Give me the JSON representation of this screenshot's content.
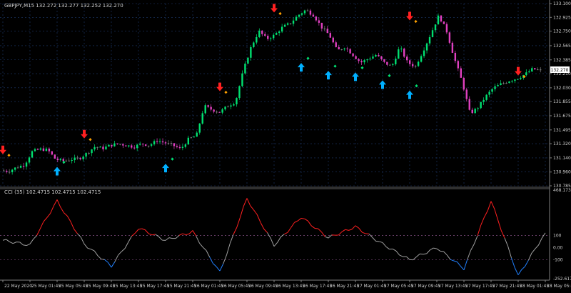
{
  "main": {
    "header": "GBPJPY,M15  132.272 132.277 132.252 132.270",
    "price_labels": [
      "133.100",
      "132.925",
      "132.750",
      "132.565",
      "132.385",
      "132.210",
      "132.030",
      "131.855",
      "131.675",
      "131.495",
      "131.320",
      "131.140",
      "130.960",
      "130.785"
    ],
    "current_price": "132.270"
  },
  "indicator": {
    "header": "CCI (35) 102.4715 102.4715 102.4715",
    "scale_labels": [
      "468.1737",
      "100",
      "0.00",
      "-100",
      "-252.6179"
    ]
  },
  "time_axis": [
    "22 May 2020",
    "25 May 01:45",
    "25 May 05:45",
    "25 May 09:45",
    "25 May 13:45",
    "25 May 17:45",
    "25 May 21:45",
    "26 May 01:45",
    "26 May 05:45",
    "26 May 09:45",
    "26 May 13:45",
    "26 May 17:45",
    "26 May 21:45",
    "27 May 01:45",
    "27 May 05:45",
    "27 May 09:45",
    "27 May 13:45",
    "27 May 17:45",
    "27 May 21:45",
    "28 May 01:45",
    "28 May 05:45"
  ],
  "colors": {
    "bull": "#00e070",
    "bear": "#e040c0",
    "neutral": "#808080",
    "cci_above": "#ff2020",
    "cci_mid": "#a0a0a0",
    "cci_below": "#2080ff",
    "buy_arrow": "#00b0ff",
    "sell_arrow": "#ff2020",
    "grid": "#1e3a6e",
    "text": "#d0d0d0"
  },
  "chart_data": [
    {
      "type": "candlestick",
      "title": "GBPJPY,M15",
      "ylim": [
        130.785,
        133.1
      ],
      "x_ticks": [
        "22 May 2020",
        "25 May 01:45",
        "25 May 05:45",
        "25 May 09:45",
        "25 May 13:45",
        "25 May 17:45",
        "25 May 21:45",
        "26 May 01:45",
        "26 May 05:45",
        "26 May 09:45",
        "26 May 13:45",
        "26 May 17:45",
        "26 May 21:45",
        "27 May 01:45",
        "27 May 05:45",
        "27 May 09:45",
        "27 May 13:45",
        "27 May 17:45",
        "27 May 21:45",
        "28 May 01:45",
        "28 May 05:45"
      ],
      "close_path": [
        130.98,
        130.97,
        131.02,
        131.05,
        131.22,
        131.25,
        131.24,
        131.12,
        131.1,
        131.12,
        131.13,
        131.2,
        131.28,
        131.26,
        131.3,
        131.32,
        131.3,
        131.28,
        131.32,
        131.3,
        131.36,
        131.33,
        131.3,
        131.25,
        131.38,
        131.42,
        131.8,
        131.75,
        131.72,
        131.8,
        131.85,
        132.25,
        132.55,
        132.75,
        132.65,
        132.7,
        132.8,
        132.85,
        132.95,
        133.02,
        132.95,
        132.8,
        132.7,
        132.5,
        132.55,
        132.45,
        132.35,
        132.4,
        132.45,
        132.35,
        132.3,
        132.55,
        132.35,
        132.3,
        132.5,
        132.72,
        132.95,
        132.75,
        132.4,
        132.1,
        131.7,
        131.78,
        131.92,
        132.03,
        132.08,
        132.12,
        132.15,
        132.2,
        132.27,
        132.25
      ],
      "buy_signals": [
        {
          "x": "25 May 05:45",
          "y": 131.08
        },
        {
          "x": "25 May 21:45",
          "y": 131.12
        },
        {
          "x": "26 May 17:45",
          "y": 132.4
        },
        {
          "x": "26 May 21:45",
          "y": 132.3
        },
        {
          "x": "27 May 01:45",
          "y": 132.28
        },
        {
          "x": "27 May 05:45",
          "y": 132.18
        },
        {
          "x": "27 May 09:45",
          "y": 132.05
        }
      ],
      "sell_signals": [
        {
          "x": "22 May 2020",
          "y": 131.15
        },
        {
          "x": "25 May 09:45",
          "y": 131.35
        },
        {
          "x": "26 May 05:45",
          "y": 131.95
        },
        {
          "x": "26 May 13:45",
          "y": 132.95
        },
        {
          "x": "27 May 09:45",
          "y": 132.85
        },
        {
          "x": "28 May 01:45",
          "y": 132.15
        }
      ]
    },
    {
      "type": "line",
      "title": "CCI (35)",
      "ylim": [
        -252.6179,
        468.1737
      ],
      "levels": [
        100,
        0,
        -100
      ],
      "x": [
        "22 May 2020",
        "25 May 01:45",
        "25 May 05:45",
        "25 May 09:45",
        "25 May 13:45",
        "25 May 17:45",
        "25 May 21:45",
        "26 May 01:45",
        "26 May 05:45",
        "26 May 09:45",
        "26 May 13:45",
        "26 May 17:45",
        "26 May 21:45",
        "27 May 01:45",
        "27 May 05:45",
        "27 May 09:45",
        "27 May 13:45",
        "27 May 17:45",
        "27 May 21:45",
        "28 May 01:45",
        "28 May 05:45"
      ],
      "values": [
        60,
        20,
        380,
        30,
        -150,
        160,
        60,
        130,
        -200,
        400,
        20,
        250,
        80,
        170,
        30,
        -100,
        0,
        -170,
        380,
        -230,
        120
      ]
    }
  ]
}
